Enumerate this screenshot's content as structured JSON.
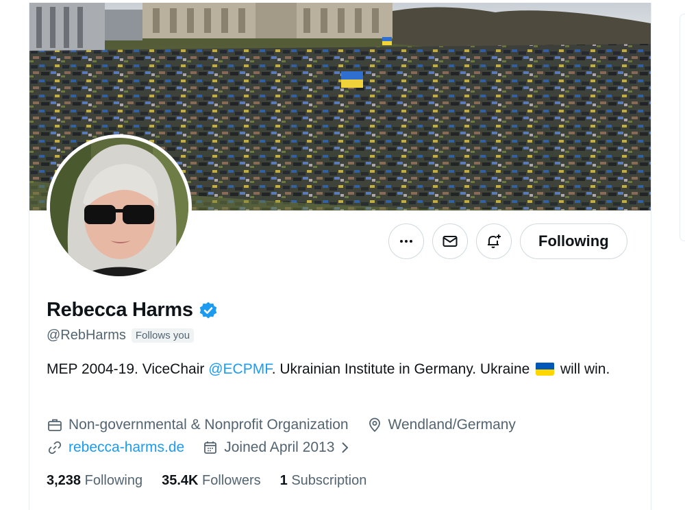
{
  "profile": {
    "name": "Rebecca Harms",
    "handle": "@RebHarms",
    "follows_you": "Follows you",
    "bio_prefix": "MEP 2004-19. ViceChair ",
    "bio_mention": "@ECPMF",
    "bio_middle": ". Ukrainian Institute in Germany. Ukraine ",
    "bio_suffix": " will win.",
    "category": "Non-governmental & Nonprofit Organization",
    "location": "Wendland/Germany",
    "website": "rebecca-harms.de",
    "joined": "Joined April 2013"
  },
  "actions": {
    "following_label": "Following"
  },
  "stats": {
    "following_count": "3,238",
    "following_label": "Following",
    "followers_count": "35.4K",
    "followers_label": "Followers",
    "subscriptions_count": "1",
    "subscriptions_label": "Subscription"
  },
  "icons": {
    "more": "more-icon",
    "message": "envelope-icon",
    "notify": "bell-plus-icon",
    "verified": "verified-badge-icon",
    "category": "briefcase-icon",
    "location": "location-pin-icon",
    "website": "link-icon",
    "joined": "calendar-icon",
    "joined_chevron": "chevron-right-icon"
  },
  "colors": {
    "accent": "#1d9bf0",
    "text": "#0f1419",
    "muted": "#536471",
    "ukraine_blue": "#0057b7",
    "ukraine_yellow": "#ffd700"
  }
}
